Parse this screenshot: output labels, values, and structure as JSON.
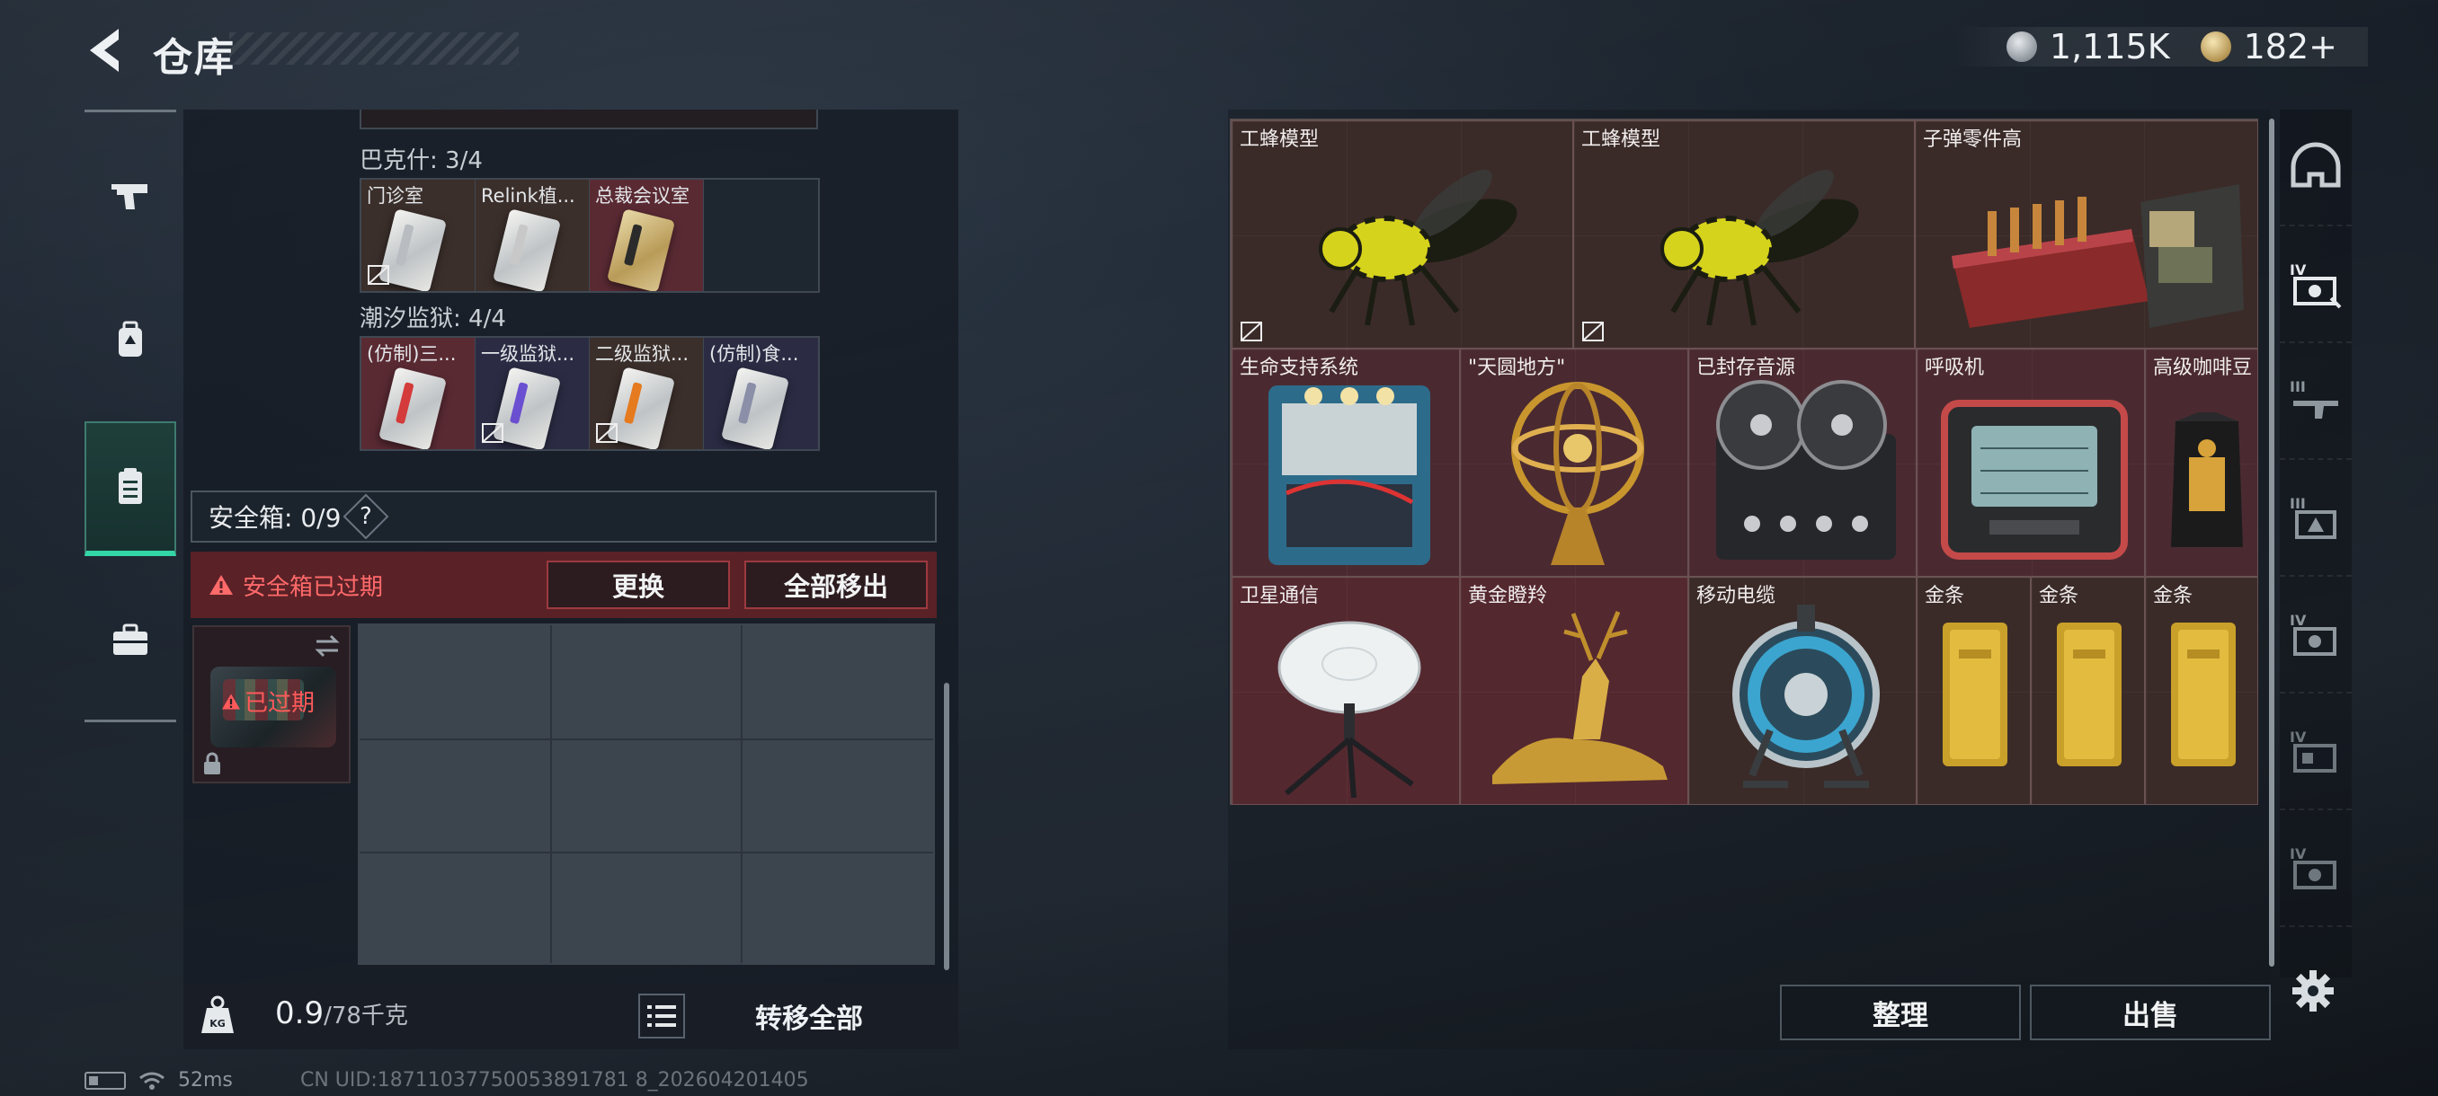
{
  "header": {
    "title": "仓库",
    "currency": [
      {
        "icon": "silver-coin-icon",
        "value": "1,115K"
      },
      {
        "icon": "gold-coin-icon",
        "value": "182+"
      }
    ]
  },
  "left_nav": [
    {
      "icon": "pistol-icon",
      "active": false
    },
    {
      "icon": "backpack-icon",
      "active": false
    },
    {
      "icon": "clipboard-icon",
      "active": true
    },
    {
      "icon": "briefcase-icon",
      "active": false
    }
  ],
  "key_groups": [
    {
      "title": "巴克什: 3/4",
      "items": [
        {
          "name": "门诊室",
          "stripe": "#b9bcc0",
          "bound": true
        },
        {
          "name": "Relink植...",
          "stripe": "#c8c8c8",
          "bound": false
        },
        {
          "name": "总裁会议室",
          "stripe": "#2b2b2b",
          "bound": false
        },
        {
          "name": "",
          "empty": true
        }
      ]
    },
    {
      "title": "潮汐监狱: 4/4",
      "items": [
        {
          "name": "(仿制)三...",
          "stripe": "#d43b3b",
          "bound": false
        },
        {
          "name": "一级监狱...",
          "stripe": "#6b4fd1",
          "bound": true
        },
        {
          "name": "二级监狱...",
          "stripe": "#e57a1f",
          "bound": true
        },
        {
          "name": "(仿制)食...",
          "stripe": "#8b8fa8",
          "bound": false
        }
      ]
    }
  ],
  "safebox": {
    "label": "安全箱: 0/9",
    "help": "?",
    "expired_text": "安全箱已过期",
    "replace_label": "更换",
    "move_all_label": "全部移出",
    "case_expired_label": "已过期"
  },
  "bottom": {
    "weight_value": "0.9",
    "weight_capacity": "/78千克",
    "transfer_label": "转移全部"
  },
  "status_bar": {
    "ping": "52ms",
    "uid": "CN UID:18711037750053891781 8_202604201405"
  },
  "stash_items": [
    {
      "name": "工蜂模型",
      "art": "wasp",
      "bound": true
    },
    {
      "name": "工蜂模型",
      "art": "wasp",
      "bound": true
    },
    {
      "name": "子弹零件高",
      "art": "ammo-parts"
    },
    {
      "name": "生命支持系统",
      "art": "life-support"
    },
    {
      "name": "\"天圆地方\"",
      "art": "armillary"
    },
    {
      "name": "已封存音源",
      "art": "reel"
    },
    {
      "name": "呼吸机",
      "art": "ventilator"
    },
    {
      "name": "高级咖啡豆",
      "art": "coffee"
    },
    {
      "name": "卫星通信",
      "art": "satellite"
    },
    {
      "name": "黄金瞪羚",
      "art": "gazelle"
    },
    {
      "name": "移动电缆",
      "art": "cable-reel"
    },
    {
      "name": "金条",
      "art": "gold-bar"
    },
    {
      "name": "金条",
      "art": "gold-bar"
    },
    {
      "name": "金条",
      "art": "gold-bar"
    }
  ],
  "stash_buttons": {
    "sort_label": "整理",
    "sell_label": "出售"
  },
  "right_nav": [
    {
      "icon": "helmet-icon",
      "tier": ""
    },
    {
      "icon": "armor-iv-icon",
      "tier": "IV"
    },
    {
      "icon": "rifle-iii-icon",
      "tier": "III"
    },
    {
      "icon": "backpack-iii-icon",
      "tier": "III"
    },
    {
      "icon": "armor-iv-icon",
      "tier": "IV"
    },
    {
      "icon": "rig-iv-icon",
      "tier": "IV"
    },
    {
      "icon": "armor-iv-icon",
      "tier": "IV"
    }
  ],
  "colors": {
    "accent_green": "#33d6a6",
    "warning_red": "#ff6a6a",
    "expired_bar": "#5a2127"
  }
}
